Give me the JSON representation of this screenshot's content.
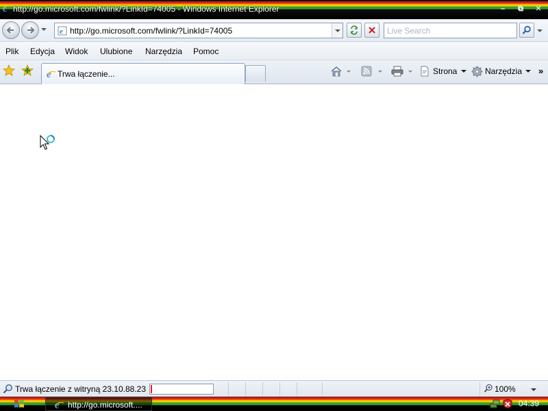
{
  "window": {
    "title": "http://go.microsoft.com/fwlink/?LinkId=74005 - Windows Internet Explorer",
    "minimize_icon": "minimize-icon",
    "restore_icon": "restore-icon",
    "close_icon": "close-icon"
  },
  "address_bar": {
    "url": "http://go.microsoft.com/fwlink/?LinkId=74005",
    "refresh_icon": "refresh-icon",
    "stop_icon": "stop-icon"
  },
  "search": {
    "placeholder": "Live Search",
    "button_icon": "magnifier-icon"
  },
  "menu": {
    "items": [
      "Plik",
      "Edycja",
      "Widok",
      "Ulubione",
      "Narzędzia",
      "Pomoc"
    ]
  },
  "tab": {
    "title": "Trwa łączenie..."
  },
  "command_bar": {
    "page_label": "Strona",
    "tools_label": "Narzędzia",
    "more": "»"
  },
  "status": {
    "text": "Trwa łączenie z witryną 23.10.88.23",
    "progress": 0.02,
    "zoom": "100%"
  },
  "taskbar": {
    "task_label": "http://go.microsoft....",
    "clock": "04:39"
  },
  "colors": {
    "stripe_red": "#d21a1a",
    "stripe_yellow": "#f7d100",
    "stripe_green": "#3aa43a",
    "progress_fill": "#e02020"
  }
}
